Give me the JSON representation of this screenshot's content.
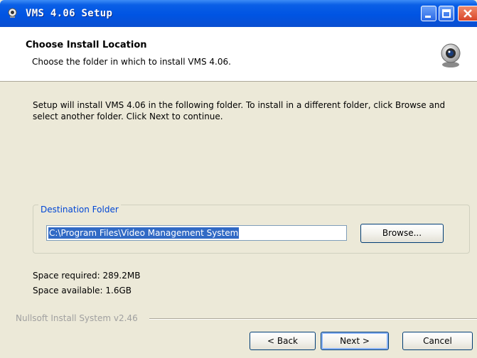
{
  "window": {
    "title": "VMS 4.06 Setup",
    "app_icon": "webcam-icon",
    "controls": [
      "minimize-icon",
      "maximize-icon",
      "close-icon"
    ]
  },
  "header": {
    "title": "Choose Install Location",
    "subtitle": "Choose the folder in which to install VMS 4.06.",
    "icon": "webcam-icon"
  },
  "main": {
    "instructions": "Setup will install VMS 4.06 in the following folder. To install in a different folder, click Browse and select another folder. Click Next to continue.",
    "destination": {
      "legend": "Destination Folder",
      "path_value": "C:\\Program Files\\Video Management System",
      "browse_label": "Browse..."
    },
    "space_required": "Space required: 289.2MB",
    "space_available": "Space available: 1.6GB"
  },
  "footer": {
    "brand": "Nullsoft Install System v2.46",
    "back_label": "< Back",
    "next_label": "Next >",
    "cancel_label": "Cancel"
  },
  "colors": {
    "titlebar": "#0054e3",
    "legend_text": "#0046d5",
    "selection": "#316ac5",
    "dialog_bg": "#ece9d8"
  }
}
